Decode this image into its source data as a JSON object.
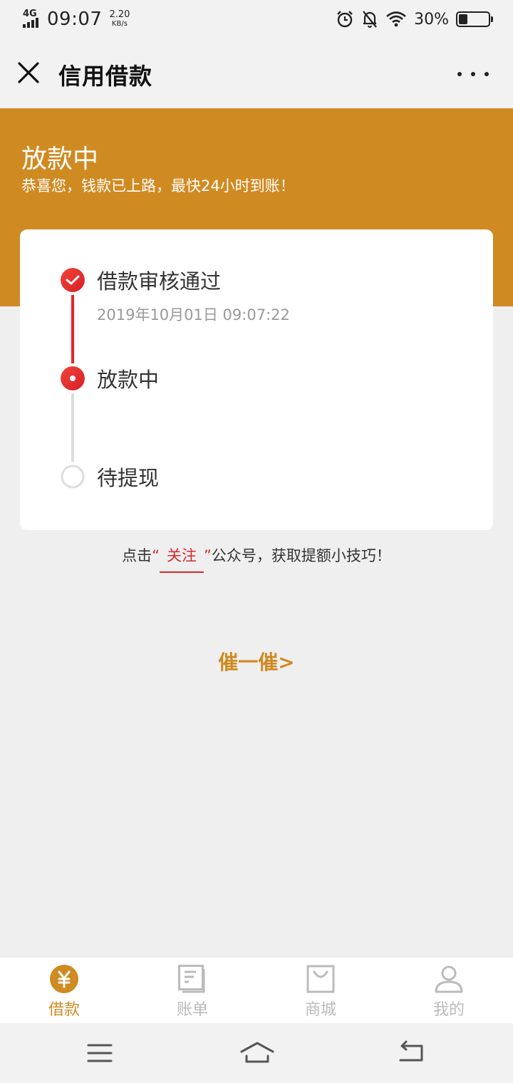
{
  "status_bar": {
    "network": "4G",
    "time": "09:07",
    "speed_value": "2.20",
    "speed_unit": "KB/s",
    "battery_percent_text": "30%",
    "battery_level": 0.3,
    "icons": [
      "alarm-icon",
      "bell-off-icon",
      "wifi-icon",
      "battery-icon"
    ]
  },
  "nav": {
    "title": "信用借款",
    "close_icon": "close-icon",
    "more_icon": "more-icon"
  },
  "banner": {
    "title": "放款中",
    "subtitle": "恭喜您，钱款已上路，最快24小时到账！",
    "color": "#d08a22"
  },
  "progress": {
    "steps": [
      {
        "label": "借款审核通过",
        "time": "2019年10月01日 09:07:22",
        "state": "done"
      },
      {
        "label": "放款中",
        "time": "",
        "state": "current"
      },
      {
        "label": "待提现",
        "time": "",
        "state": "pending"
      }
    ],
    "active_color": "#e8242b",
    "inactive_color": "#dddddd"
  },
  "follow_tip": {
    "prefix": "点击",
    "open_quote": "“",
    "link": "关注",
    "close_quote": "”",
    "suffix": "公众号，获取提额小技巧！"
  },
  "urge_button": "催一催>",
  "tab_bar": {
    "items": [
      {
        "label": "借款",
        "icon": "yuan-icon",
        "active": true
      },
      {
        "label": "账单",
        "icon": "bill-icon",
        "active": false
      },
      {
        "label": "商城",
        "icon": "shop-bag-icon",
        "active": false
      },
      {
        "label": "我的",
        "icon": "user-icon",
        "active": false
      }
    ],
    "active_color": "#d08a22",
    "inactive_color": "#bbbbbb"
  },
  "system_nav": {
    "icons": [
      "menu-icon",
      "home-icon",
      "back-icon"
    ]
  }
}
